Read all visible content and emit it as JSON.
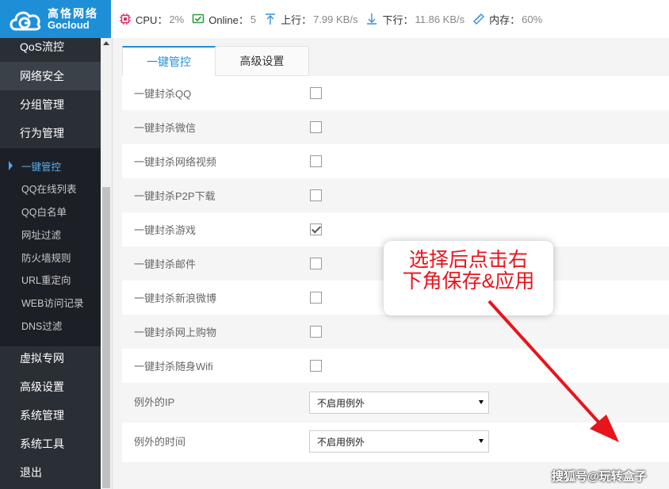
{
  "brand": {
    "name_cn": "高恪网络",
    "name_en": "Gocloud"
  },
  "status": {
    "cpu_label": "CPU：",
    "cpu_value": "2%",
    "online_label": "Online：",
    "online_value": "5",
    "up_label": "上行：",
    "up_value": "7.99 KB/s",
    "down_label": "下行：",
    "down_value": "11.86 KB/s",
    "mem_label": "内存：",
    "mem_value": "60%"
  },
  "sidebar": {
    "top_items": [
      "QoS流控",
      "网络安全",
      "分组管理",
      "行为管理"
    ],
    "sub_items": [
      "一键管控",
      "QQ在线列表",
      "QQ白名单",
      "网址过滤",
      "防火墙规则",
      "URL重定向",
      "WEB访问记录",
      "DNS过滤"
    ],
    "bottom_items": [
      "虚拟专网",
      "高级设置",
      "系统管理",
      "系统工具",
      "退出"
    ]
  },
  "tabs": [
    "一键管控",
    "高级设置"
  ],
  "rows": [
    {
      "label": "一键封杀QQ",
      "checked": false
    },
    {
      "label": "一键封杀微信",
      "checked": false
    },
    {
      "label": "一键封杀网络视频",
      "checked": false
    },
    {
      "label": "一键封杀P2P下载",
      "checked": false
    },
    {
      "label": "一键封杀游戏",
      "checked": true
    },
    {
      "label": "一键封杀邮件",
      "checked": false
    },
    {
      "label": "一键封杀新浪微博",
      "checked": false
    },
    {
      "label": "一键封杀网上购物",
      "checked": false
    },
    {
      "label": "一键封杀随身Wifi",
      "checked": false
    }
  ],
  "exceptions": [
    {
      "label": "例外的IP",
      "value": "不启用例外"
    },
    {
      "label": "例外的时间",
      "value": "不启用例外"
    }
  ],
  "annotation": {
    "line1": "选择后点击右",
    "line2": "下角保存&应用"
  },
  "watermark": "搜狐号@玩转盒子",
  "colors": {
    "accent": "#1e8fd7",
    "sidebar": "#2a2f36",
    "annotation": "#e8141c"
  }
}
